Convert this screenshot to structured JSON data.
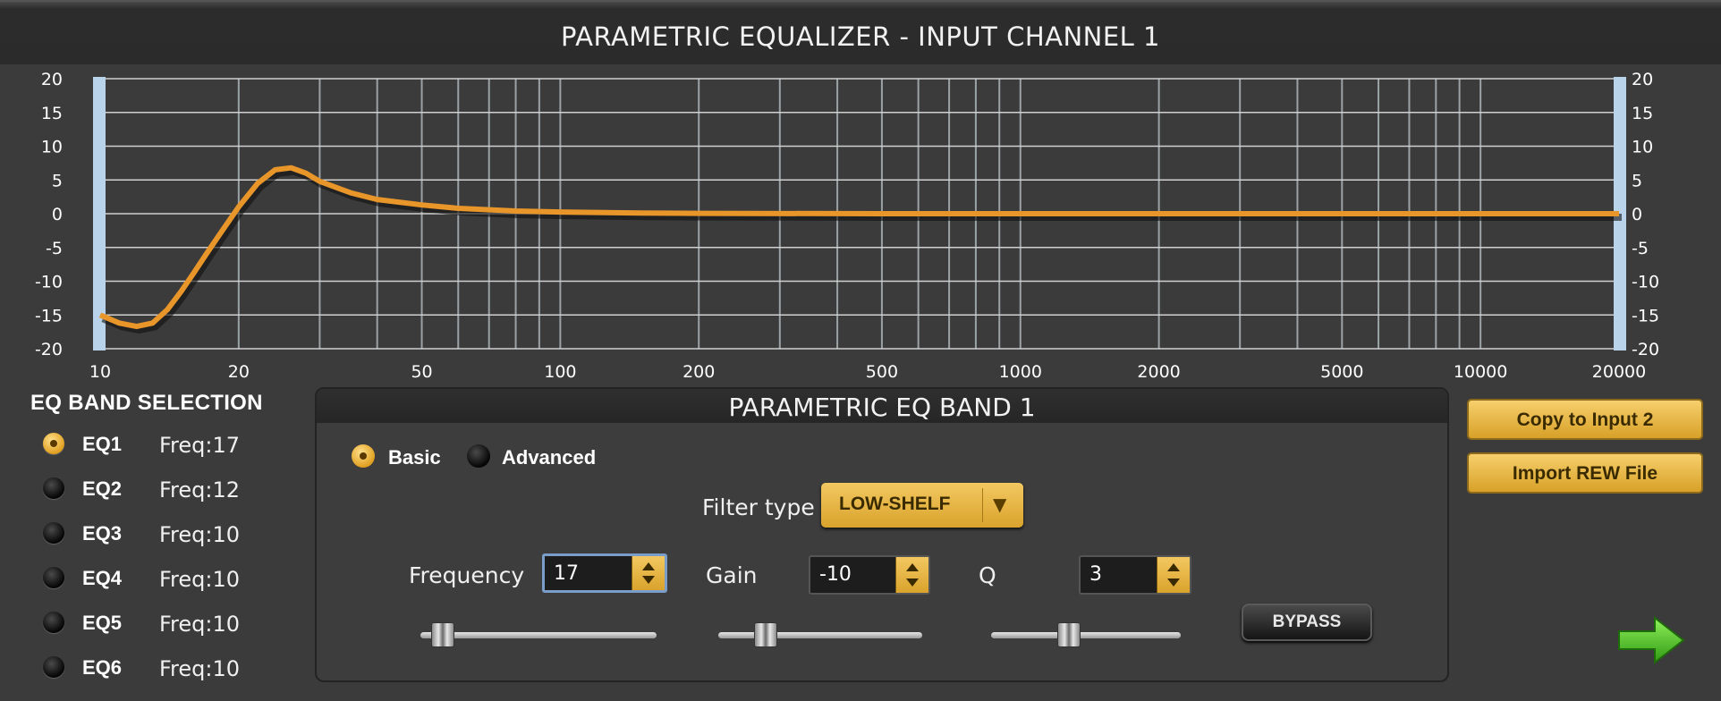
{
  "window": {
    "title": "PARAMETRIC EQUALIZER - INPUT CHANNEL 1"
  },
  "graph": {
    "y_ticks": [
      "20",
      "15",
      "10",
      "5",
      "0",
      "-5",
      "-10",
      "-15",
      "-20"
    ],
    "x_ticks": [
      "10",
      "20",
      "50",
      "100",
      "200",
      "500",
      "1000",
      "2000",
      "5000",
      "10000",
      "20000"
    ],
    "colors": {
      "curve": "#e8952a",
      "grid": "#9aa2a6",
      "background": "#3b3b3b",
      "edge_bars": "#b9d3ea"
    }
  },
  "chart_data": {
    "type": "line",
    "xscale": "log",
    "xlim": [
      10,
      20000
    ],
    "ylim": [
      -20,
      20
    ],
    "x": [
      10,
      11,
      12,
      13,
      14,
      15,
      16,
      17,
      18,
      20,
      22,
      24,
      26,
      28,
      30,
      35,
      40,
      50,
      60,
      80,
      100,
      150,
      200,
      500,
      1000,
      2000,
      5000,
      10000,
      20000
    ],
    "series": [
      {
        "values": [
          -15,
          -16.2,
          -16.7,
          -16.2,
          -14.2,
          -11.5,
          -8.7,
          -6,
          -3.5,
          1,
          4.5,
          6.5,
          6.8,
          6,
          4.8,
          3.1,
          2.1,
          1.3,
          0.8,
          0.4,
          0.25,
          0.1,
          0.05,
          0,
          0,
          0,
          0,
          0,
          0
        ]
      }
    ],
    "grid": true
  },
  "band_selection": {
    "title": "EQ BAND SELECTION",
    "bands": [
      {
        "label": "EQ1",
        "freq": "Freq:17",
        "selected": true
      },
      {
        "label": "EQ2",
        "freq": "Freq:12",
        "selected": false
      },
      {
        "label": "EQ3",
        "freq": "Freq:10",
        "selected": false
      },
      {
        "label": "EQ4",
        "freq": "Freq:10",
        "selected": false
      },
      {
        "label": "EQ5",
        "freq": "Freq:10",
        "selected": false
      },
      {
        "label": "EQ6",
        "freq": "Freq:10",
        "selected": false
      }
    ]
  },
  "band_panel": {
    "title": "PARAMETRIC EQ BAND 1",
    "mode_basic": "Basic",
    "mode_advanced": "Advanced",
    "filter_type_label": "Filter type",
    "filter_type_value": "LOW-SHELF",
    "frequency_label": "Frequency",
    "frequency_value": "17",
    "gain_label": "Gain",
    "gain_value": "-10",
    "q_label": "Q",
    "q_value": "3",
    "frequency_slider_level": 0.05,
    "gain_slider_level": 0.2,
    "q_slider_level": 0.4,
    "bypass_label": "BYPASS"
  },
  "actions": {
    "copy_label": "Copy to Input 2",
    "import_label": "Import REW File",
    "next_icon": "right-arrow-icon"
  }
}
